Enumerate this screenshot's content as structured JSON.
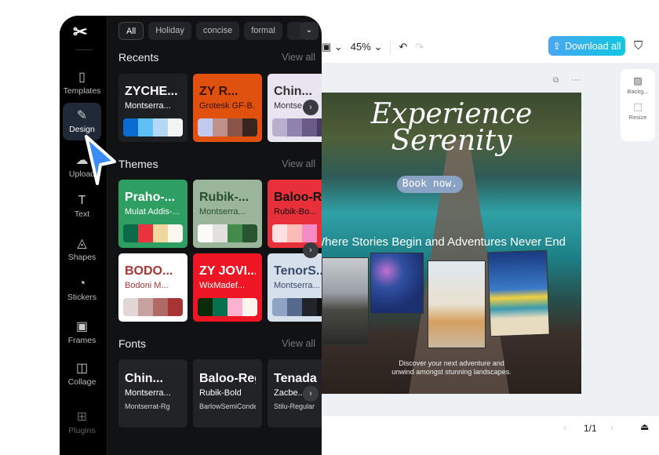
{
  "toolbar": {
    "zoom": "45%",
    "download_label": "Download all"
  },
  "side_panel": {
    "background": "Backg...",
    "resize": "Resize"
  },
  "pager": {
    "page": "1/1"
  },
  "poster": {
    "title1": "Experience",
    "title2": "Serenity",
    "book": "Book now.",
    "tagline": "Where Stories Begin and Adventures Never End",
    "desc1": "Discover your next adventure and",
    "desc2": "unwind amongst stunning landscapes."
  },
  "rail": {
    "items": [
      {
        "label": "Templates",
        "icon": "▯"
      },
      {
        "label": "Design",
        "icon": "✎"
      },
      {
        "label": "Upload",
        "icon": "☁"
      },
      {
        "label": "Text",
        "icon": "T"
      },
      {
        "label": "Shapes",
        "icon": "◬"
      },
      {
        "label": "Stickers",
        "icon": "◔"
      },
      {
        "label": "Frames",
        "icon": "▣"
      },
      {
        "label": "Collage",
        "icon": "◫"
      },
      {
        "label": "Plugins",
        "icon": "⊞"
      }
    ]
  },
  "filters": [
    "All",
    "Holiday",
    "concise",
    "formal"
  ],
  "sections": {
    "recents": "Recents",
    "themes": "Themes",
    "fonts": "Fonts",
    "view_all": "View all"
  },
  "recents": [
    {
      "t1": "ZYCHE...",
      "t2": "Montserra...",
      "bg": "#1e1f22",
      "fg": "#fff",
      "colors": [
        "#0a6bd1",
        "#5ec0f5",
        "#b3d8f5",
        "#f3f3f3"
      ]
    },
    {
      "t1": "ZY R...",
      "t2": "Grotesk GF-B...",
      "bg": "#e0500f",
      "fg": "#3a1208",
      "colors": [
        "#c3c9ee",
        "#c0918a",
        "#8a5448",
        "#3a2420"
      ]
    },
    {
      "t1": "Chin...",
      "t2": "Montse...",
      "bg": "#e8e4f0",
      "fg": "#333",
      "colors": [
        "#b9b0d0",
        "#8f82ad",
        "#6a5a88",
        "#4a3a66"
      ]
    }
  ],
  "themes": [
    {
      "t1": "Praho-...",
      "t2": "Mulat Addis-...",
      "bg": "#2e9e63",
      "fg": "#fff",
      "colors": [
        "#0b6b48",
        "#e8343e",
        "#efd79e",
        "#faf8ee"
      ]
    },
    {
      "t1": "Rubik-...",
      "t2": "Montserra...",
      "bg": "#9bb59b",
      "fg": "#264d2e",
      "colors": [
        "#fbfaf8",
        "#e3e1de",
        "#448a4a",
        "#285530"
      ]
    },
    {
      "t1": "Baloo-Regu...",
      "t2": "Rubik-Bo...",
      "bg": "#e8303a",
      "fg": "#111",
      "colors": [
        "#fde0e4",
        "#fbbcb7",
        "#f68ac5",
        "#e8303a"
      ]
    },
    {
      "t1": "BODO...",
      "t2": "Bodoni M...",
      "bg": "#fff",
      "fg": "#a83333",
      "colors": [
        "#e2d6d6",
        "#c8a2a0",
        "#b06a66",
        "#a83333"
      ]
    },
    {
      "t1": "ZY JOVI...",
      "t2": "WixMadef...",
      "bg": "#ee1525",
      "fg": "#fff",
      "colors": [
        "#0a2c0a",
        "#07704e",
        "#fdb0d0",
        "#faf6ee"
      ]
    },
    {
      "t1": "TenorS...",
      "t2": "Montserra...",
      "bg": "#d6e0ec",
      "fg": "#3a4a6a",
      "colors": [
        "#8ea4c4",
        "#566a8e",
        "#22242c",
        "#111"
      ]
    }
  ],
  "fonts": [
    {
      "t1": "Chin...",
      "t2": "Montserra...",
      "t3": "Montserrat-Rg"
    },
    {
      "t1": "Baloo-Regul...",
      "t2": "Rubik-Bold",
      "t3": "BarlowSemiConden..."
    },
    {
      "t1": "Tenada",
      "t2": "Zacbe...",
      "t3": "Stilu-Regular"
    }
  ]
}
